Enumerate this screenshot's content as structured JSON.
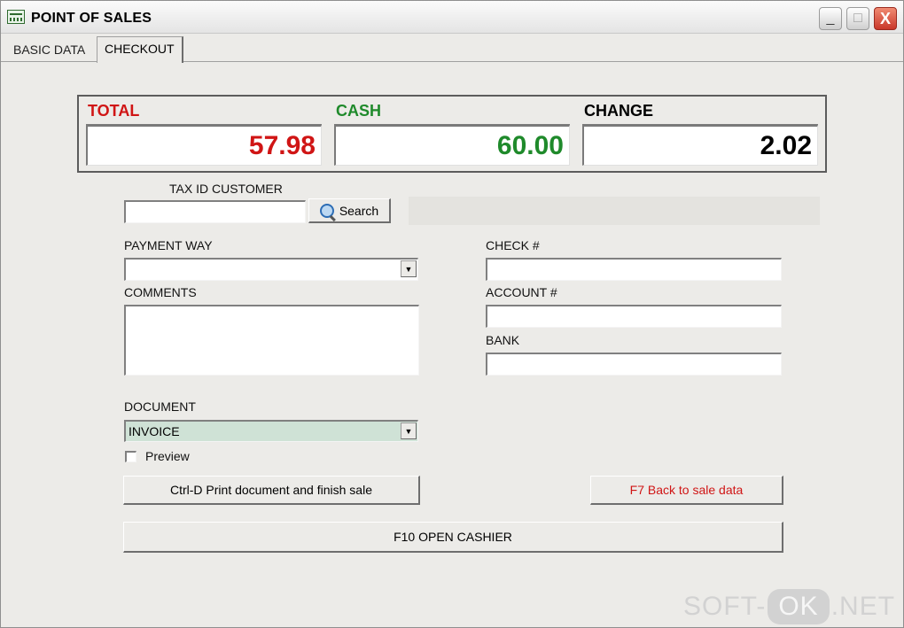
{
  "window": {
    "title": "POINT OF SALES",
    "controls": {
      "minimize": "_",
      "maximize": "□",
      "close": "X"
    }
  },
  "tabs": [
    {
      "label": "BASIC DATA",
      "active": false
    },
    {
      "label": "CHECKOUT",
      "active": true
    }
  ],
  "summary": {
    "total": {
      "label": "TOTAL",
      "value": "57.98",
      "color": "#d01515"
    },
    "cash": {
      "label": "CASH",
      "value": "60.00",
      "color": "#1f8a2b"
    },
    "change": {
      "label": "CHANGE",
      "value": "2.02",
      "color": "#000000"
    }
  },
  "customer": {
    "label": "TAX ID  CUSTOMER",
    "tax_id_value": "",
    "search_label": "Search",
    "customer_name": ""
  },
  "payment_way": {
    "label": "PAYMENT WAY",
    "selected": ""
  },
  "comments": {
    "label": "COMMENTS",
    "value": ""
  },
  "check": {
    "label": "CHECK #",
    "value": ""
  },
  "account": {
    "label": "ACCOUNT #",
    "value": ""
  },
  "bank": {
    "label": "BANK",
    "value": ""
  },
  "document": {
    "label": "DOCUMENT",
    "selected": "INVOICE"
  },
  "preview": {
    "label": "Preview",
    "checked": false
  },
  "buttons": {
    "print_finish": "Ctrl-D Print document and finish sale",
    "back_to_sale": "F7 Back to sale data",
    "open_cashier": "F10 OPEN CASHIER"
  },
  "colors": {
    "back_button_text": "#d01515"
  },
  "watermark": {
    "part1": "SOFT-",
    "part2": "OK",
    "part3": ".NET"
  }
}
